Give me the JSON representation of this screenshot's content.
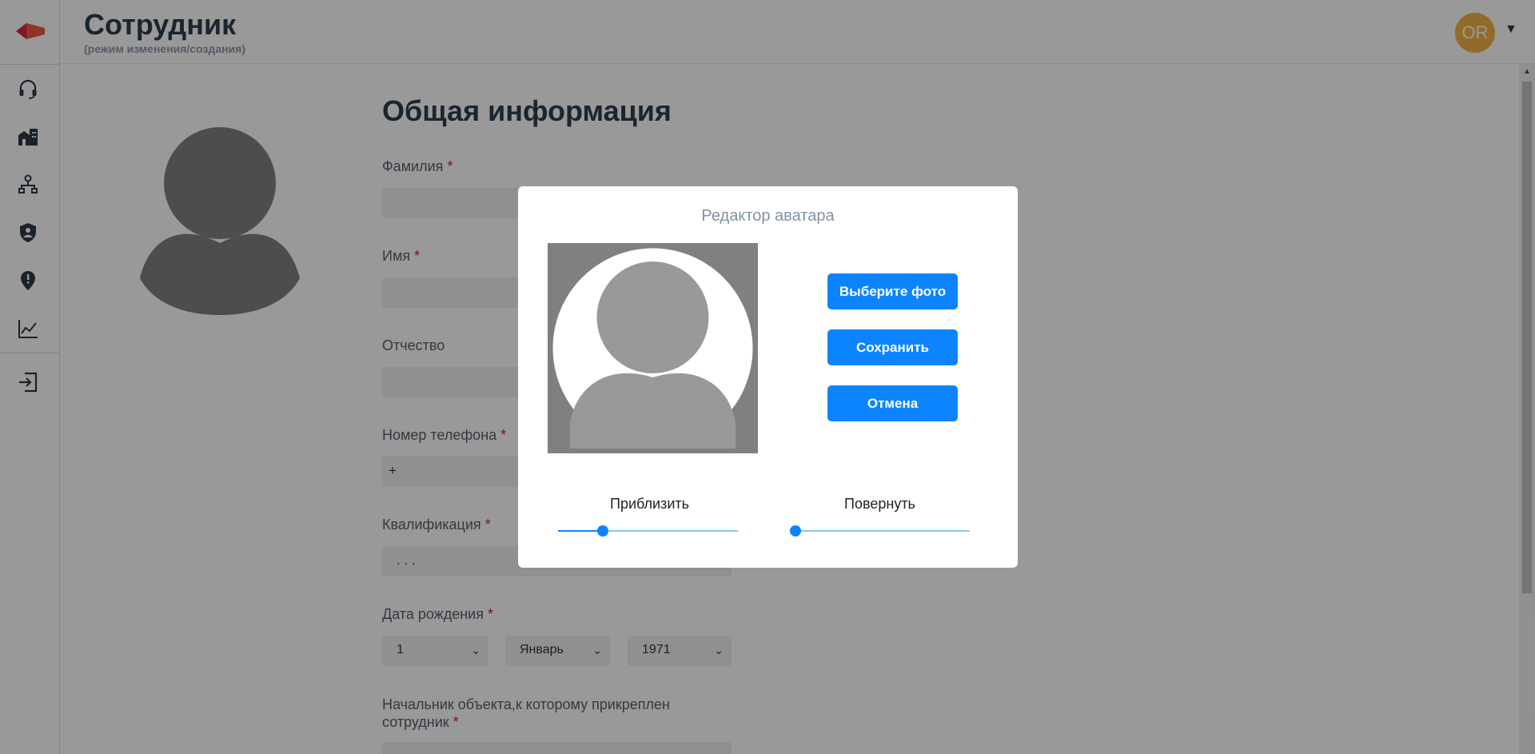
{
  "header": {
    "title": "Сотрудник",
    "subtitle": "(режим изменения/создания)",
    "user_initials": "OR",
    "user_menu_caret": "▼"
  },
  "sidebar": {
    "items": [
      {
        "icon": "headset-icon"
      },
      {
        "icon": "buildings-icon"
      },
      {
        "icon": "org-structure-icon"
      },
      {
        "icon": "shield-user-icon"
      },
      {
        "icon": "location-alert-icon"
      },
      {
        "icon": "chart-line-icon"
      },
      {
        "icon": "logout-icon"
      }
    ]
  },
  "form": {
    "section_title": "Общая информация",
    "required_mark": "*",
    "fields": {
      "last_name": {
        "label": "Фамилия",
        "value": ""
      },
      "first_name": {
        "label": "Имя",
        "value": ""
      },
      "patronymic": {
        "label": "Отчество",
        "value": ""
      },
      "phone": {
        "label": "Номер телефона",
        "value": "+"
      },
      "qualification": {
        "label": "Квалификация",
        "value": ". . ."
      },
      "birth_date": {
        "label": "Дата рождения",
        "day": "1",
        "month": "Январь",
        "year": "1971"
      },
      "supervisor": {
        "label": "Начальник объекта,к которому прикреплен сотрудник"
      }
    }
  },
  "modal": {
    "title": "Редактор аватара",
    "buttons": {
      "choose_photo": "Выберите фото",
      "save": "Сохранить",
      "cancel": "Отмена"
    },
    "zoom": {
      "label": "Приблизить",
      "value": 0.25
    },
    "rotate": {
      "label": "Повернуть",
      "value": 0.03
    }
  },
  "colors": {
    "accent": "#0d84ff",
    "avatar_bg": "#f2b247",
    "required": "#d0202a"
  }
}
